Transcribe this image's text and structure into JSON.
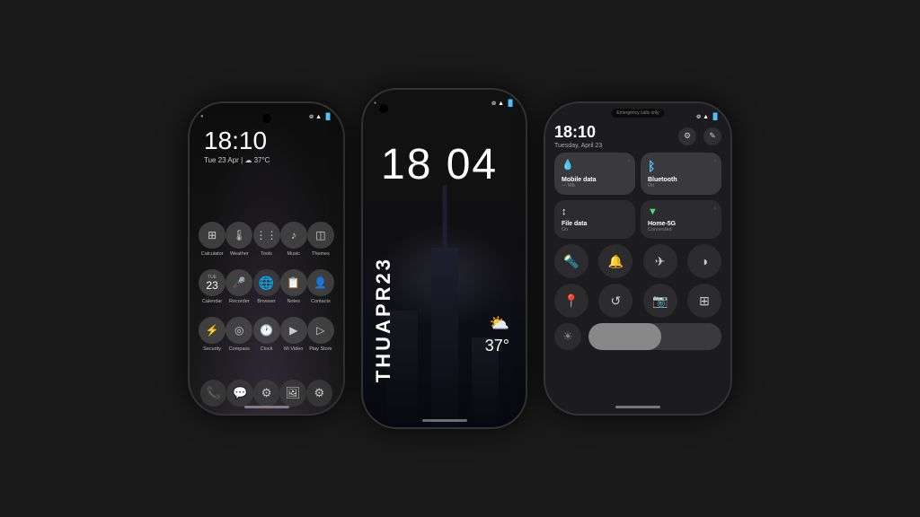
{
  "phones": {
    "phone1": {
      "time": "18:10",
      "date": "Tue 23 Apr |  ☁ 37°C",
      "status": {
        "bt": "᪤",
        "wifi": "▲",
        "signal": "●●●",
        "battery": "🔋"
      },
      "apps_row1": [
        {
          "icon": "⊞",
          "label": "Calculator"
        },
        {
          "icon": "🌡",
          "label": "Weather"
        },
        {
          "icon": "🔧",
          "label": "Tools"
        },
        {
          "icon": "♪",
          "label": "Music"
        },
        {
          "icon": "◫",
          "label": "Themes"
        }
      ],
      "apps_row2": [
        {
          "icon": "📅",
          "label": "Calendar"
        },
        {
          "icon": "🎤",
          "label": "Recorder"
        },
        {
          "icon": "🌐",
          "label": "Browser"
        },
        {
          "icon": "📝",
          "label": "Notes"
        },
        {
          "icon": "👤",
          "label": "Contacts"
        }
      ],
      "apps_row3": [
        {
          "icon": "⚡",
          "label": "Security"
        },
        {
          "icon": "▲",
          "label": "Compass"
        },
        {
          "icon": "⏰",
          "label": "Clock"
        },
        {
          "icon": "▶",
          "label": "Mi Video"
        },
        {
          "icon": "▷",
          "label": "Play Store"
        }
      ],
      "dock": [
        {
          "icon": "📞"
        },
        {
          "icon": "💬"
        },
        {
          "icon": "⚙"
        },
        {
          "icon": "🖼"
        },
        {
          "icon": "⚙"
        }
      ]
    },
    "phone2": {
      "time": "18 04",
      "status": {
        "bt": "*",
        "signal": "●●●"
      },
      "vertical_date": "THUAPR23",
      "weather": "⛅",
      "temp": "37°"
    },
    "phone3": {
      "status_top": "Emergency calls only",
      "status_icons": "᪤🔷",
      "time": "18:10",
      "date": "Tuesday, April 23",
      "tiles_row1": [
        {
          "label": "Mobile data",
          "sublabel": "— Mb",
          "icon": "💧",
          "iconColor": "blue",
          "hasArrow": true
        },
        {
          "label": "Bluetooth",
          "sublabel": "On",
          "icon": "ᛒ",
          "iconColor": "blue",
          "hasArrow": true
        }
      ],
      "tiles_row2": [
        {
          "label": "File data",
          "sublabel": "On",
          "icon": "↕",
          "iconColor": "white",
          "hasArrow": false
        },
        {
          "label": "Home-5G",
          "sublabel": "Connected",
          "icon": "▼",
          "iconColor": "green",
          "hasArrow": true
        }
      ],
      "circles_row1": [
        "🔦",
        "🔔",
        "✈",
        "◑"
      ],
      "circles_row2": [
        "📍",
        "↺",
        "📷",
        "⊞"
      ],
      "brightness_level": 55,
      "brightness_icon": "☀"
    }
  },
  "colors": {
    "phone_bg": "#111111",
    "screen_dark": "#0d0d0d",
    "tile_bg": "#2c2c2e",
    "tile_active": "#3a3a3c",
    "text_white": "#ffffff",
    "text_gray": "#888888",
    "accent_blue": "#4fc3f7"
  }
}
